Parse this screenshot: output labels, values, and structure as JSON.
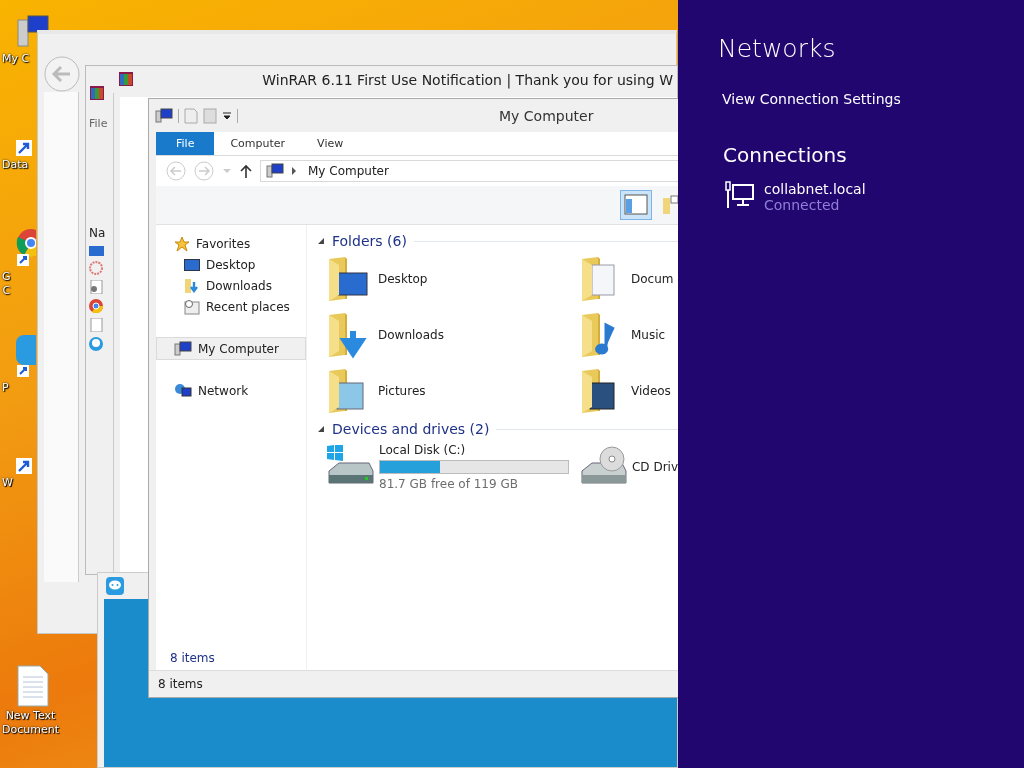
{
  "desktop": {
    "icons": [
      {
        "kind": "computer",
        "lines": [
          "My C"
        ]
      },
      {
        "kind": "shortcut",
        "lines": [
          "Data"
        ]
      },
      {
        "kind": "chrome",
        "lines": [
          "G",
          "C"
        ]
      },
      {
        "kind": "app",
        "lines": [
          "P"
        ]
      },
      {
        "kind": "shortcut",
        "lines": [
          "W"
        ]
      },
      {
        "kind": "textfile",
        "lines": [
          "New Text",
          "Document"
        ]
      }
    ]
  },
  "winrar": {
    "title": "WinRAR 6.11 First Use Notification | Thank you for using W",
    "menu": "File",
    "column": "Na"
  },
  "explorer": {
    "title": "My Computer",
    "tabs": [
      {
        "label": "File",
        "selected": true
      },
      {
        "label": "Computer",
        "selected": false
      },
      {
        "label": "View",
        "selected": false
      }
    ],
    "address": "My Computer",
    "sidebar": [
      {
        "kind": "favorites",
        "label": "Favorites",
        "selected": false,
        "children": [
          {
            "kind": "desktop",
            "label": "Desktop",
            "selected": false
          },
          {
            "kind": "downloads",
            "label": "Downloads",
            "selected": false
          },
          {
            "kind": "recent",
            "label": "Recent places",
            "selected": false
          }
        ]
      },
      {
        "kind": "computer",
        "label": "My Computer",
        "selected": true
      },
      {
        "kind": "network",
        "label": "Network",
        "selected": false
      }
    ],
    "folders_header": "Folders (6)",
    "folders": [
      {
        "kind": "desktop",
        "label": "Desktop"
      },
      {
        "kind": "documents",
        "label": "Docum"
      },
      {
        "kind": "downloads",
        "label": "Downloads"
      },
      {
        "kind": "music",
        "label": "Music"
      },
      {
        "kind": "pictures",
        "label": "Pictures"
      },
      {
        "kind": "videos",
        "label": "Videos"
      }
    ],
    "drives_header": "Devices and drives (2)",
    "drives": [
      {
        "kind": "disk",
        "label": "Local Disk (C:)",
        "level": 0.32,
        "free": "81.7 GB free of 119 GB"
      },
      {
        "kind": "cd",
        "label": "CD Driv"
      }
    ],
    "inner_status": "8 items",
    "status_bar": "8 items"
  },
  "networks": {
    "title": "Networks",
    "settings_link": "View Connection Settings",
    "connections_header": "Connections",
    "connections": [
      {
        "name": "collabnet.local",
        "status": "Connected"
      }
    ]
  }
}
